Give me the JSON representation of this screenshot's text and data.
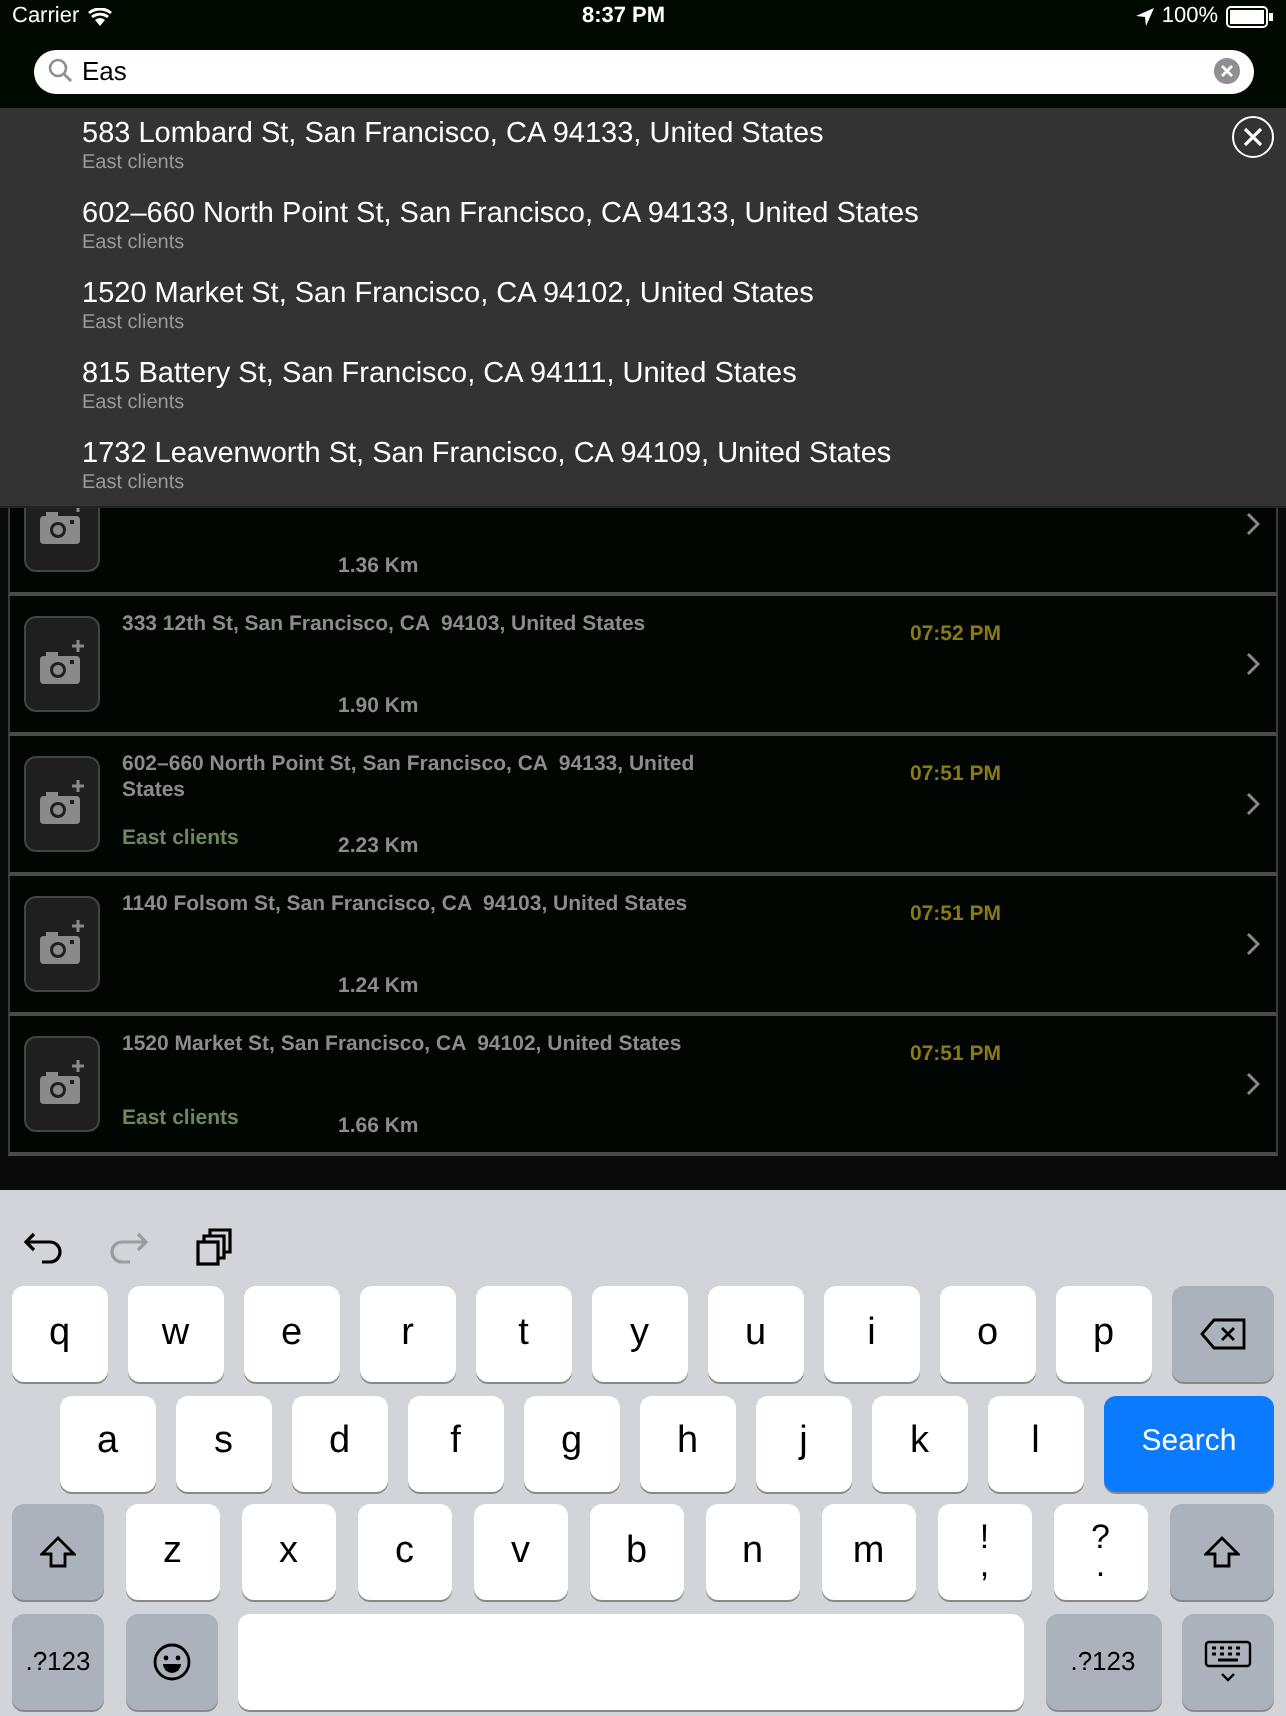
{
  "status_bar": {
    "carrier": "Carrier",
    "time": "8:37 PM",
    "battery": "100%"
  },
  "search": {
    "value": "Eas"
  },
  "suggestions": [
    {
      "address": "583 Lombard St, San Francisco, CA  94133, United States",
      "group": "East clients"
    },
    {
      "address": "602–660 North Point St, San Francisco, CA  94133, United States",
      "group": "East clients"
    },
    {
      "address": "1520 Market St, San Francisco, CA  94102, United States",
      "group": "East clients"
    },
    {
      "address": "815 Battery St, San Francisco, CA  94111, United States",
      "group": "East clients"
    },
    {
      "address": "1732 Leavenworth St, San Francisco, CA  94109, United States",
      "group": "East clients"
    }
  ],
  "rows": [
    {
      "kind": "partial",
      "distance": "1.36 Km"
    },
    {
      "kind": "full",
      "address": "333 12th St, San Francisco, CA  94103, United States",
      "time": "07:52 PM",
      "distance": "1.90 Km"
    },
    {
      "kind": "full",
      "address": "602–660 North Point St, San Francisco, CA  94133, United States",
      "time": "07:51 PM",
      "group": "East clients",
      "distance": "2.23 Km"
    },
    {
      "kind": "full",
      "address": "1140 Folsom St, San Francisco, CA  94103, United States",
      "time": "07:51 PM",
      "distance": "1.24 Km"
    },
    {
      "kind": "full",
      "address": "1520 Market St, San Francisco, CA  94102, United States",
      "time": "07:51 PM",
      "group": "East clients",
      "distance": "1.66 Km"
    }
  ],
  "keyboard_toolbar": [
    {
      "kind": "undo",
      "disabled": false
    },
    {
      "kind": "redo",
      "disabled": true
    },
    {
      "kind": "paste",
      "disabled": false
    }
  ],
  "keyboard": [
    [
      {
        "kind": "letter",
        "label": "q"
      },
      {
        "kind": "letter",
        "label": "w"
      },
      {
        "kind": "letter",
        "label": "e"
      },
      {
        "kind": "letter",
        "label": "r"
      },
      {
        "kind": "letter",
        "label": "t"
      },
      {
        "kind": "letter",
        "label": "y"
      },
      {
        "kind": "letter",
        "label": "u"
      },
      {
        "kind": "letter",
        "label": "i"
      },
      {
        "kind": "letter",
        "label": "o"
      },
      {
        "kind": "letter",
        "label": "p"
      },
      {
        "kind": "delete"
      }
    ],
    [
      {
        "kind": "letter",
        "label": "a"
      },
      {
        "kind": "letter",
        "label": "s"
      },
      {
        "kind": "letter",
        "label": "d"
      },
      {
        "kind": "letter",
        "label": "f"
      },
      {
        "kind": "letter",
        "label": "g"
      },
      {
        "kind": "letter",
        "label": "h"
      },
      {
        "kind": "letter",
        "label": "j"
      },
      {
        "kind": "letter",
        "label": "k"
      },
      {
        "kind": "letter",
        "label": "l"
      },
      {
        "kind": "search",
        "label": "Search"
      }
    ],
    [
      {
        "kind": "shift"
      },
      {
        "kind": "letter",
        "label": "z"
      },
      {
        "kind": "letter",
        "label": "x"
      },
      {
        "kind": "letter",
        "label": "c"
      },
      {
        "kind": "letter",
        "label": "v"
      },
      {
        "kind": "letter",
        "label": "b"
      },
      {
        "kind": "letter",
        "label": "n"
      },
      {
        "kind": "letter",
        "label": "m"
      },
      {
        "kind": "dual",
        "top": "!",
        "bottom": ","
      },
      {
        "kind": "dual",
        "top": "?",
        "bottom": "."
      },
      {
        "kind": "shift"
      }
    ],
    [
      {
        "kind": "numbers",
        "label": ".?123"
      },
      {
        "kind": "emoji"
      },
      {
        "kind": "space"
      },
      {
        "kind": "numbers",
        "label": ".?123"
      },
      {
        "kind": "hide"
      }
    ]
  ]
}
